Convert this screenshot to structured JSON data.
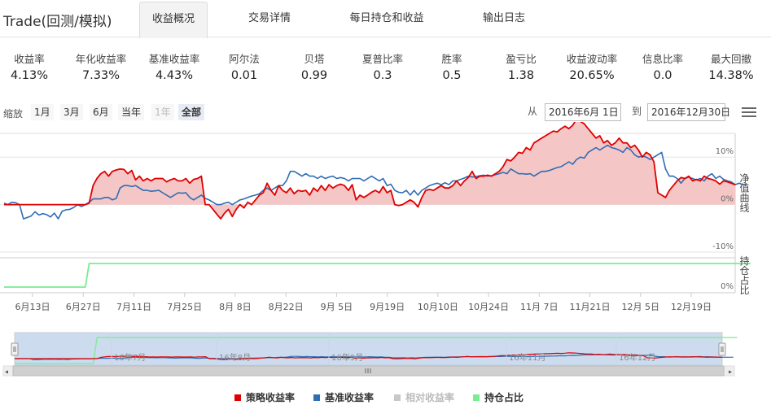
{
  "app_title": "Trade(回测/模拟)",
  "tabs": [
    {
      "label": "收益概况",
      "active": true
    },
    {
      "label": "交易详情",
      "active": false
    },
    {
      "label": "每日持仓和收益",
      "active": false
    },
    {
      "label": "输出日志",
      "active": false
    }
  ],
  "metrics": [
    {
      "label": "收益率",
      "value": "4.13%"
    },
    {
      "label": "年化收益率",
      "value": "7.33%"
    },
    {
      "label": "基准收益率",
      "value": "4.43%"
    },
    {
      "label": "阿尔法",
      "value": "0.01"
    },
    {
      "label": "贝塔",
      "value": "0.99"
    },
    {
      "label": "夏普比率",
      "value": "0.3"
    },
    {
      "label": "胜率",
      "value": "0.5"
    },
    {
      "label": "盈亏比",
      "value": "1.38"
    },
    {
      "label": "收益波动率",
      "value": "20.65%"
    },
    {
      "label": "信息比率",
      "value": "0.0"
    },
    {
      "label": "最大回撤",
      "value": "14.38%"
    }
  ],
  "zoom": {
    "label": "缩放",
    "buttons": [
      {
        "label": "1月",
        "state": "normal"
      },
      {
        "label": "3月",
        "state": "normal"
      },
      {
        "label": "6月",
        "state": "normal"
      },
      {
        "label": "当年",
        "state": "normal"
      },
      {
        "label": "1年",
        "state": "disabled"
      },
      {
        "label": "全部",
        "state": "selected"
      }
    ]
  },
  "range": {
    "from_label": "从",
    "from_value": "2016年6月 1日",
    "to_label": "到",
    "to_value": "2016年12月30日"
  },
  "colors": {
    "strategy": "#e00000",
    "benchmark": "#2f6db5",
    "relative": "#c8c8c8",
    "position": "#77ee8f",
    "fill": "#f5c6c6"
  },
  "icons": {
    "menu": "hamburger-menu-icon"
  },
  "chart_data": {
    "type": "line",
    "x_ticks": [
      "6月13日",
      "6月27日",
      "7月11日",
      "7月25日",
      "8月 8日",
      "8月22日",
      "9月 5日",
      "9月19日",
      "10月10日",
      "10月24日",
      "11月 7日",
      "11月21日",
      "12月 5日",
      "12月19日"
    ],
    "panels": [
      {
        "ylabel": "净值曲线",
        "yticks": [
          "10%",
          "0%",
          "-10%"
        ],
        "ylim": [
          -10,
          15
        ]
      },
      {
        "ylabel": "持仓占比",
        "yticks": [
          "0%"
        ],
        "ylim": [
          0,
          100
        ]
      }
    ],
    "series": [
      {
        "name": "策略收益率",
        "visible": true,
        "values": [
          0.0,
          0.0,
          0.0,
          0.0,
          0.0,
          0.0,
          0.0,
          0.0,
          0.0,
          0.0,
          0.0,
          0.0,
          0.0,
          0.0,
          0.0,
          0.0,
          0.0,
          0.0,
          0.0,
          0.0,
          0.0,
          0.0,
          0.3,
          4.0,
          5.5,
          6.5,
          7.0,
          6.0,
          7.0,
          7.3,
          7.5,
          7.4,
          6.5,
          7.2,
          5.2,
          6.0,
          5.0,
          5.5,
          5.0,
          5.5,
          5.5,
          5.5,
          4.8,
          5.2,
          5.5,
          5.0,
          5.0,
          5.5,
          4.5,
          5.3,
          5.5,
          6.0,
          0.0,
          0.0,
          -1.0,
          -2.0,
          -3.0,
          -1.8,
          -1.0,
          -2.5,
          -1.0,
          0.0,
          -0.7,
          0.5,
          0.0,
          1.0,
          2.0,
          2.5,
          4.5,
          3.0,
          2.0,
          4.0,
          3.0,
          2.5,
          3.5,
          2.3,
          3.0,
          2.8,
          3.0,
          2.0,
          3.5,
          2.8,
          4.0,
          3.0,
          4.2,
          3.5,
          4.0,
          4.3,
          4.0,
          3.0,
          4.2,
          1.0,
          2.0,
          1.5,
          2.0,
          2.6,
          3.0,
          2.5,
          3.8,
          2.5,
          3.0,
          0.0,
          -0.2,
          0.0,
          0.5,
          1.0,
          0.5,
          -0.5,
          1.5,
          3.0,
          3.2,
          3.0,
          3.5,
          4.0,
          3.5,
          3.5,
          4.0,
          5.0,
          4.0,
          5.0,
          5.7,
          7.0,
          5.5,
          6.0,
          6.0,
          6.2,
          6.0,
          6.5,
          7.0,
          8.0,
          9.5,
          9.2,
          10.0,
          11.0,
          10.8,
          12.0,
          11.5,
          13.0,
          13.5,
          14.0,
          14.5,
          15.0,
          15.5,
          15.3,
          16.0,
          16.5,
          16.0,
          16.7,
          18.0,
          17.5,
          17.0,
          16.0,
          15.0,
          14.0,
          14.5,
          13.0,
          13.5,
          12.5,
          13.0,
          14.0,
          13.0,
          13.0,
          12.0,
          12.5,
          11.5,
          10.0,
          11.0,
          10.5,
          9.0,
          2.5,
          2.0,
          1.5,
          3.0,
          4.0,
          5.0,
          5.7,
          5.5,
          6.0,
          5.0,
          5.3,
          5.0,
          6.0,
          5.5,
          5.3,
          5.0,
          4.3,
          5.0,
          4.8,
          4.5,
          4.2
        ]
      },
      {
        "name": "基准收益率",
        "visible": true,
        "values": [
          0.3,
          0.0,
          0.5,
          0.4,
          0.0,
          -3.0,
          -2.7,
          -2.4,
          -1.5,
          -2.2,
          -1.9,
          -2.1,
          -2.6,
          -1.8,
          -3.0,
          -1.4,
          -1.1,
          -1.0,
          -0.6,
          0.0,
          -0.4,
          0.0,
          0.5,
          1.2,
          1.2,
          1.2,
          1.5,
          1.5,
          1.0,
          1.3,
          3.5,
          4.0,
          4.0,
          3.8,
          4.0,
          3.5,
          3.0,
          3.0,
          2.8,
          2.9,
          3.0,
          2.5,
          2.0,
          1.5,
          2.0,
          2.5,
          2.4,
          2.5,
          1.5,
          1.0,
          1.5,
          2.0,
          1.3,
          1.0,
          0.5,
          0.0,
          0.0,
          0.3,
          0.5,
          0.0,
          0.5,
          1.0,
          1.2,
          1.5,
          1.8,
          2.0,
          2.3,
          3.0,
          3.5,
          3.0,
          3.5,
          4.0,
          4.0,
          5.0,
          7.0,
          7.0,
          6.5,
          6.0,
          6.5,
          6.0,
          6.0,
          5.5,
          6.0,
          5.5,
          5.8,
          6.0,
          5.5,
          5.7,
          5.5,
          5.0,
          5.5,
          5.5,
          5.5,
          5.0,
          5.5,
          6.0,
          5.5,
          5.0,
          5.5,
          4.0,
          4.3,
          3.0,
          2.6,
          2.5,
          3.0,
          2.0,
          3.0,
          2.0,
          3.0,
          3.5,
          4.0,
          4.3,
          4.5,
          4.2,
          4.6,
          4.2,
          5.0,
          5.0,
          5.3,
          5.6,
          6.0,
          5.8,
          5.9,
          6.1,
          6.2,
          6.0,
          6.1,
          6.3,
          6.5,
          6.8,
          6.5,
          7.5,
          7.0,
          6.5,
          6.5,
          6.4,
          6.5,
          6.0,
          6.5,
          7.0,
          7.0,
          7.2,
          7.5,
          7.8,
          8.0,
          8.5,
          9.0,
          8.5,
          9.5,
          10.0,
          9.8,
          11.0,
          11.5,
          12.0,
          11.5,
          12.0,
          12.5,
          12.0,
          11.8,
          11.5,
          11.0,
          12.0,
          11.5,
          10.5,
          10.0,
          10.2,
          10.0,
          9.5,
          10.0,
          10.5,
          11.0,
          7.5,
          6.0,
          6.0,
          5.5,
          4.5,
          5.5,
          5.8,
          5.5,
          5.2,
          5.5,
          5.0,
          6.0,
          6.5,
          5.5,
          6.0,
          5.3,
          5.0,
          4.8,
          4.2,
          4.5,
          4.2,
          4.4
        ]
      },
      {
        "name": "相对收益率",
        "visible": false,
        "values": []
      },
      {
        "name": "持仓占比",
        "visible": true,
        "values": [
          0,
          0,
          0,
          0,
          0,
          0,
          0,
          0,
          0,
          0,
          0,
          0,
          0,
          0,
          0,
          0,
          0,
          0,
          0,
          0,
          0,
          0,
          100,
          100,
          100,
          100,
          100,
          100,
          100,
          100,
          100,
          100,
          100,
          100,
          100,
          100,
          100,
          100,
          100,
          100,
          100,
          100,
          100,
          100,
          100,
          100,
          100,
          100,
          100,
          100,
          100,
          100,
          100,
          100,
          100,
          100,
          100,
          100,
          100,
          100,
          100,
          100,
          100,
          100,
          100,
          100,
          100,
          100,
          100,
          100,
          100,
          100,
          100,
          100,
          100,
          100,
          100,
          100,
          100,
          100,
          100,
          100,
          100,
          100,
          100,
          100,
          100,
          100,
          100,
          100,
          100,
          100,
          100,
          100,
          100,
          100,
          100,
          100,
          100,
          100,
          100,
          100,
          100,
          100,
          100,
          100,
          100,
          100,
          100,
          100,
          100,
          100,
          100,
          100,
          100,
          100,
          100,
          100,
          100,
          100,
          100,
          100,
          100,
          100,
          100,
          100,
          100,
          100,
          100,
          100,
          100,
          100,
          100,
          100,
          100,
          100,
          100,
          100,
          100,
          100,
          100,
          100,
          100,
          100,
          100,
          100,
          100,
          100,
          100,
          100,
          100,
          100,
          100,
          100,
          100,
          100,
          100,
          100,
          100,
          100,
          100,
          100,
          100,
          100,
          100,
          100,
          100,
          100,
          100,
          100,
          100,
          100,
          100,
          100,
          100,
          100,
          100,
          100,
          100,
          100,
          100,
          100,
          100,
          100,
          100,
          100,
          100,
          100,
          100,
          100,
          100,
          100,
          100,
          100
        ]
      }
    ],
    "navigator": {
      "x_ticks": [
        "16年7月",
        "16年8月",
        "16年9月",
        "16年11月",
        "16年12月"
      ]
    }
  }
}
